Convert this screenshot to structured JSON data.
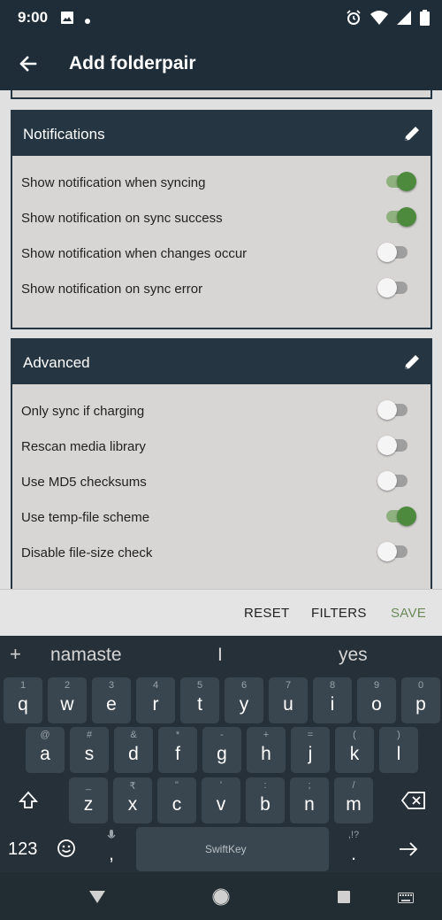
{
  "status_bar": {
    "time": "9:00"
  },
  "app_bar": {
    "title": "Add folderpair"
  },
  "sections": {
    "notifications": {
      "title": "Notifications",
      "rows": [
        {
          "label": "Show notification when syncing",
          "on": true
        },
        {
          "label": "Show notification on sync success",
          "on": true
        },
        {
          "label": "Show notification when changes occur",
          "on": false
        },
        {
          "label": "Show notification on sync error",
          "on": false
        }
      ]
    },
    "advanced": {
      "title": "Advanced",
      "rows": [
        {
          "label": "Only sync if charging",
          "on": false
        },
        {
          "label": "Rescan media library",
          "on": false
        },
        {
          "label": "Use MD5 checksums",
          "on": false
        },
        {
          "label": "Use temp-file scheme",
          "on": true
        },
        {
          "label": "Disable file-size check",
          "on": false
        }
      ]
    }
  },
  "actions": {
    "reset": "RESET",
    "filters": "FILTERS",
    "save": "SAVE"
  },
  "colors": {
    "accent_green": "#4e8a3e",
    "header_dark": "#253642",
    "save_color": "#6a8a5a"
  },
  "keyboard": {
    "suggestions": [
      "namaste",
      "I",
      "yes"
    ],
    "plus": "+",
    "row1": [
      {
        "hint": "1",
        "key": "q"
      },
      {
        "hint": "2",
        "key": "w"
      },
      {
        "hint": "3",
        "key": "e"
      },
      {
        "hint": "4",
        "key": "r"
      },
      {
        "hint": "5",
        "key": "t"
      },
      {
        "hint": "6",
        "key": "y"
      },
      {
        "hint": "7",
        "key": "u"
      },
      {
        "hint": "8",
        "key": "i"
      },
      {
        "hint": "9",
        "key": "o"
      },
      {
        "hint": "0",
        "key": "p"
      }
    ],
    "row2": [
      {
        "hint": "@",
        "key": "a"
      },
      {
        "hint": "#",
        "key": "s"
      },
      {
        "hint": "&",
        "key": "d"
      },
      {
        "hint": "*",
        "key": "f"
      },
      {
        "hint": "-",
        "key": "g"
      },
      {
        "hint": "+",
        "key": "h"
      },
      {
        "hint": "=",
        "key": "j"
      },
      {
        "hint": "(",
        "key": "k"
      },
      {
        "hint": ")",
        "key": "l"
      }
    ],
    "row3": [
      {
        "hint": "_",
        "key": "z"
      },
      {
        "hint": "₹",
        "key": "x"
      },
      {
        "hint": "\"",
        "key": "c"
      },
      {
        "hint": "'",
        "key": "v"
      },
      {
        "hint": ":",
        "key": "b"
      },
      {
        "hint": ";",
        "key": "n"
      },
      {
        "hint": "/",
        "key": "m"
      }
    ],
    "symbols_key": "123",
    "comma_key": ",",
    "period_key": ".",
    "period_hint": ",!?",
    "space_brand": "SwiftKey"
  }
}
